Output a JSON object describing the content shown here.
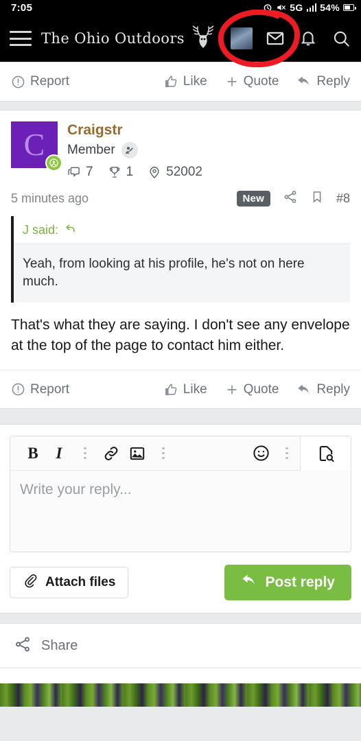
{
  "statusbar": {
    "time": "7:05",
    "battery_percent": "54%",
    "network": "5G",
    "icons": [
      "alarm-icon",
      "mute-icon",
      "network-5g-label",
      "signal-bars-icon",
      "battery-icon"
    ]
  },
  "navbar": {
    "menu_icon": "hamburger-menu-icon",
    "site_title": "The Ohio Outdoors",
    "logo_icon": "deer-antler-skull-logo",
    "avatar_icon": "user-avatar",
    "inbox_icon": "envelope-icon",
    "alerts_icon": "bell-icon",
    "search_icon": "magnifier-icon"
  },
  "annotation": {
    "shape": "hand-drawn-circle",
    "color": "#ed1c24",
    "target": "envelope-icon"
  },
  "top_actionbar": {
    "report": "Report",
    "like": "Like",
    "quote": "Quote",
    "reply": "Reply"
  },
  "post": {
    "author": "Craigstr",
    "author_color": "#9a6b2f",
    "avatar_letter": "C",
    "avatar_color": "#6b21b8",
    "role": "Member",
    "online": true,
    "stats": [
      {
        "icon": "message-bubble-icon",
        "value": "7"
      },
      {
        "icon": "trophy-icon",
        "value": "1"
      },
      {
        "icon": "location-pin-icon",
        "value": "52002"
      }
    ],
    "timestamp": "5 minutes ago",
    "new_badge": "New",
    "share_icon": "share-icon",
    "bookmark_icon": "bookmark-icon",
    "post_number": "#8",
    "quote": {
      "author_line": "J said:",
      "jump_icon": "reply-arrow-icon",
      "text": "Yeah, from looking at his profile, he's not on here much."
    },
    "body": "That's what they are saying. I don't see any envelope at the top of the page to contact him either."
  },
  "bottom_actionbar": {
    "report": "Report",
    "like": "Like",
    "quote": "Quote",
    "reply": "Reply"
  },
  "editor": {
    "toolbar": [
      {
        "name": "bold-button",
        "label": "B"
      },
      {
        "name": "italic-button",
        "label": "I"
      },
      {
        "name": "more-options-icon",
        "label": ""
      },
      {
        "name": "link-icon",
        "label": ""
      },
      {
        "name": "image-icon",
        "label": ""
      },
      {
        "name": "more-options-icon",
        "label": ""
      },
      {
        "name": "smiley-icon",
        "label": ""
      },
      {
        "name": "more-options-icon",
        "label": ""
      },
      {
        "name": "preview-icon",
        "label": ""
      }
    ],
    "placeholder": "Write your reply...",
    "value": "",
    "attach_label": "Attach files",
    "attach_icon": "paperclip-icon",
    "post_label": "Post reply",
    "post_icon": "reply-arrow-icon",
    "post_button_color": "#79bd42"
  },
  "share_row": {
    "label": "Share",
    "icon": "share-icon"
  }
}
